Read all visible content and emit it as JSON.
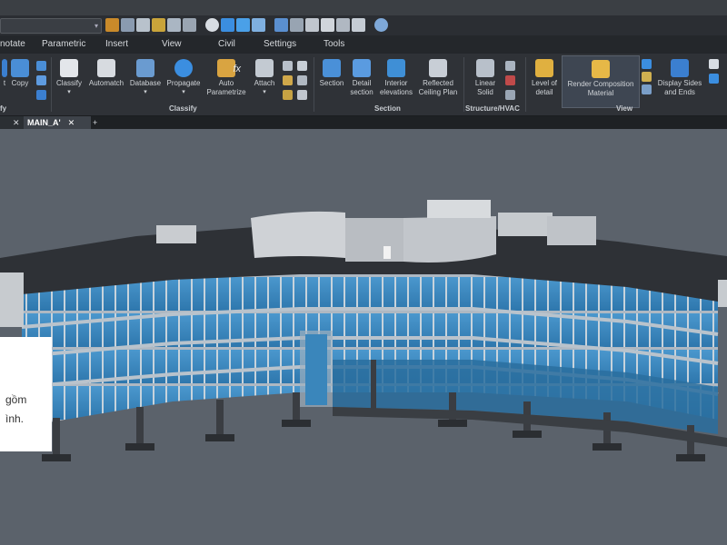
{
  "menubar": {
    "items": [
      "notate",
      "Parametric",
      "Insert",
      "View",
      "Civil",
      "Settings",
      "Tools"
    ]
  },
  "ribbon": {
    "buttons": {
      "copy": "Copy",
      "classify": "Classify",
      "automatch": "Automatch",
      "database": "Database",
      "propagate": "Propagate",
      "auto_parametrize": "Auto\nParametrize",
      "attach": "Attach",
      "section": "Section",
      "detail_section": "Detail\nsection",
      "interior_elevations": "Interior\nelevations",
      "reflected_ceiling_plan": "Reflected\nCeiling Plan",
      "linear_solid": "Linear\nSolid",
      "level_of_detail": "Level of\ndetail",
      "render_composition_material": "Render Composition\nMaterial",
      "display_sides_and_ends": "Display Sides\nand Ends"
    },
    "groups": {
      "left": "fy",
      "classify": "Classify",
      "section": "Section",
      "structure": "Structure/HVAC",
      "view": "View"
    },
    "fx_label": "fx"
  },
  "doc_tabs": {
    "active": "MAIN_A'",
    "add": "+"
  },
  "note": {
    "line1": "gồm",
    "line2": "ình."
  },
  "colors": {
    "accent": "#2f7bd6",
    "glass": "#3f8fc4",
    "active_button": "#3e4652"
  }
}
